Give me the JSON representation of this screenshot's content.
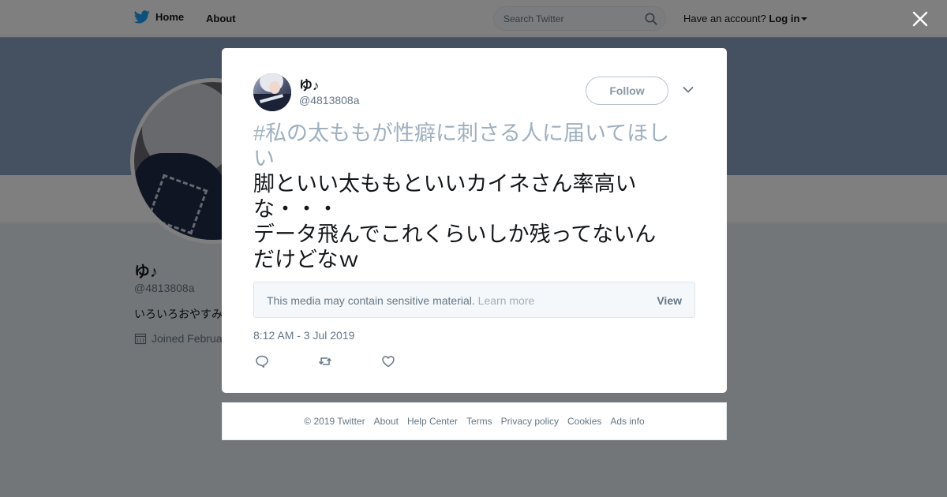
{
  "topbar": {
    "home_label": "Home",
    "about_label": "About",
    "search_placeholder": "Search Twitter",
    "account_prompt": "Have an account?",
    "login_label": "Log in"
  },
  "profile": {
    "name": "ゆ♪",
    "handle": "@4813808a",
    "bio": "いろいろおやすみ",
    "joined": "Joined Februa"
  },
  "tweet": {
    "author_name": "ゆ♪",
    "author_handle": "@4813808a",
    "follow_label": "Follow",
    "hashtag_line1": "#私の太ももが性癖に刺さる人に届いてほし",
    "hashtag_line2": "い",
    "text_line1": "脚といい太ももといいカイネさん率高い",
    "text_line2": "な・・・",
    "text_line3": "データ飛んでこれくらいしか残ってないん",
    "text_line4": "だけどなｗ",
    "sensitive_message": "This media may contain sensitive material.",
    "sensitive_learn_more": "Learn more",
    "sensitive_view": "View",
    "timestamp": "8:12 AM - 3 Jul 2019"
  },
  "footer": {
    "links": [
      "© 2019 Twitter",
      "About",
      "Help Center",
      "Terms",
      "Privacy policy",
      "Cookies",
      "Ads info"
    ]
  },
  "colors": {
    "brand": "#1da1f2",
    "banner": "#8aa1c3",
    "muted": "#657786",
    "hashtag": "#9fb0be"
  },
  "icons": [
    "twitter-bird-icon",
    "search-icon",
    "calendar-icon",
    "close-icon",
    "chevron-down-icon",
    "reply-icon",
    "retweet-icon",
    "like-icon"
  ]
}
